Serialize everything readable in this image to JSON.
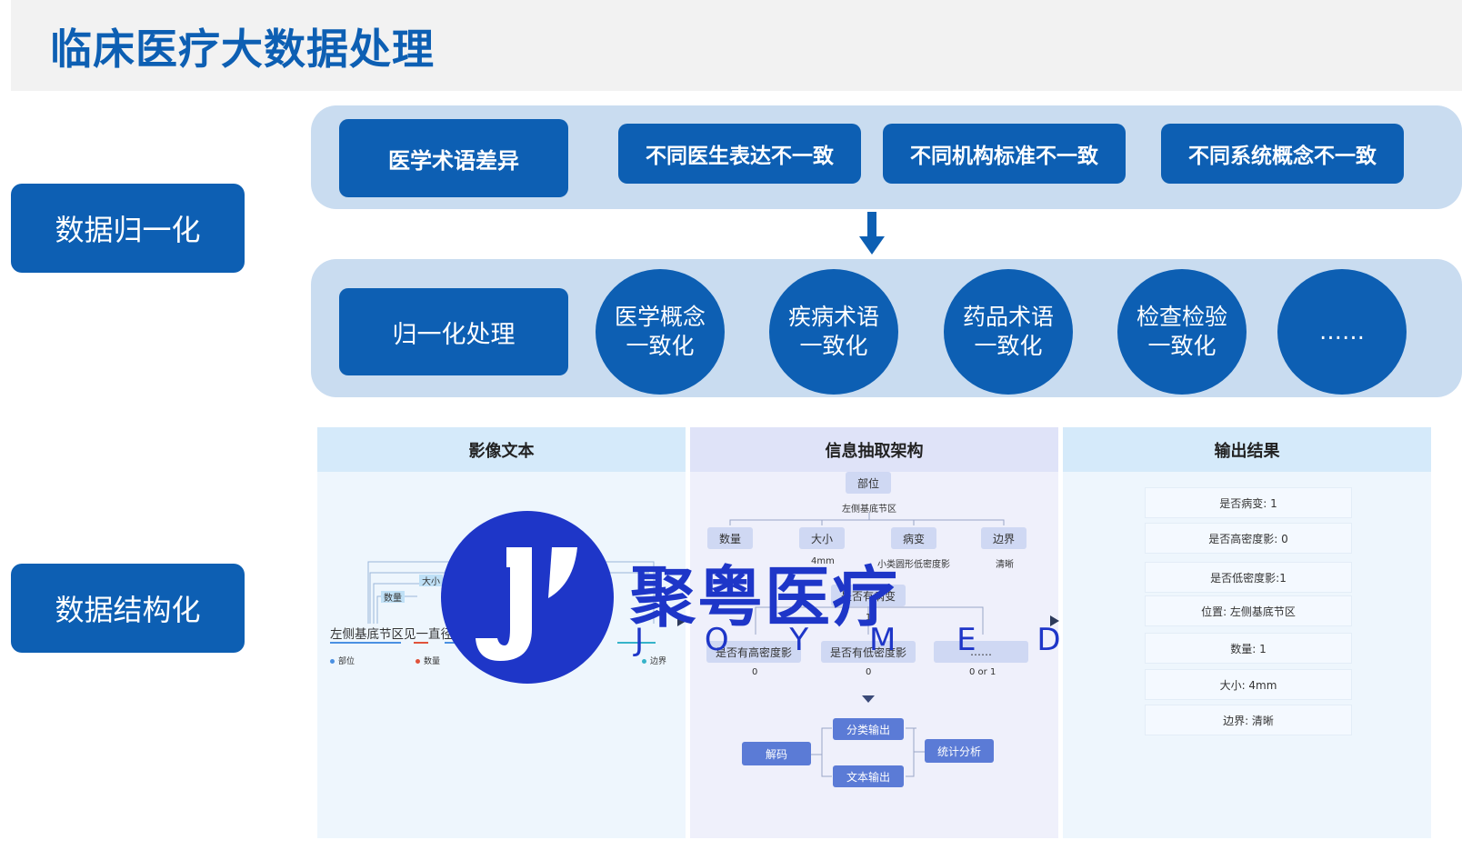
{
  "title": "临床医疗大数据处理",
  "side": {
    "normalize": "数据归一化",
    "structure": "数据结构化"
  },
  "differences": {
    "label": "医学术语差异",
    "items": [
      "不同医生表达不一致",
      "不同机构标准不一致",
      "不同系统概念不一致"
    ]
  },
  "processing": {
    "label": "归一化处理",
    "circles": [
      {
        "line1": "医学概念",
        "line2": "一致化"
      },
      {
        "line1": "疾病术语",
        "line2": "一致化"
      },
      {
        "line1": "药品术语",
        "line2": "一致化"
      },
      {
        "line1": "检查检验",
        "line2": "一致化"
      },
      {
        "line1": "……",
        "line2": ""
      }
    ]
  },
  "columns": {
    "image_text": {
      "title": "影像文本",
      "sentence": "左侧基底节区见一直径 4mm的 小类圆 边缘清晰",
      "tags": [
        "大小",
        "数量"
      ],
      "legend": [
        "部位",
        "数量",
        "边界"
      ],
      "legend_colors": [
        "#4a90e2",
        "#e0533b",
        "#36b3c9"
      ]
    },
    "extraction": {
      "title": "信息抽取架构",
      "root": "部位",
      "root_value": "左侧基底节区",
      "children": [
        "数量",
        "大小",
        "病变",
        "边界"
      ],
      "child_values": [
        "",
        "4mm",
        "小类圆形低密度影",
        "清晰"
      ],
      "mid": "是否有病变",
      "mid_value": "1",
      "leaves": [
        "是否有高密度影",
        "是否有低密度影",
        "……"
      ],
      "leaf_values": [
        "0",
        "0",
        "0 or 1"
      ],
      "decoder": "解码",
      "outputs": [
        "分类输出",
        "文本输出"
      ],
      "stats": "统计分析"
    },
    "results": {
      "title": "输出结果",
      "rows": [
        "是否病变: 1",
        "是否高密度影: 0",
        "是否低密度影:1",
        "位置: 左侧基底节区",
        "数量: 1",
        "大小: 4mm",
        "边界: 清晰"
      ]
    }
  },
  "watermark": {
    "name": "聚粤医疗",
    "letters": "J O Y M E D"
  },
  "colors": {
    "primary": "#0d5fb3",
    "panel": "#c9dcf0",
    "node": "#5b7bd6",
    "logo": "#1e36c8"
  }
}
